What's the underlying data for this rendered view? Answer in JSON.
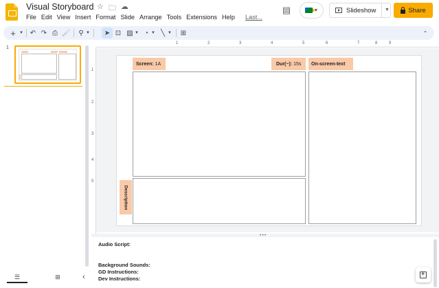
{
  "header": {
    "title": "Visual Storyboard",
    "menu": [
      "File",
      "Edit",
      "View",
      "Insert",
      "Format",
      "Slide",
      "Arrange",
      "Tools",
      "Extensions",
      "Help"
    ],
    "last_edit": "Last...",
    "slideshow_label": "Slideshow",
    "share_label": "Share",
    "accent": "#f9ab00"
  },
  "toolbar": {
    "new_label": "+",
    "zoom_icon": "zoom-icon"
  },
  "rulers": {
    "top": [
      "1",
      "2",
      "3",
      "4",
      "5",
      "6",
      "7",
      "8",
      "9"
    ],
    "left": [
      "1",
      "2",
      "3",
      "4",
      "5"
    ]
  },
  "filmstrip": {
    "slide_number": "1"
  },
  "slide": {
    "screen_label": "Screen:",
    "screen_value": "1A",
    "dur_label": "Dur(~):",
    "dur_value": "15s",
    "onscreen_label": "On-screen-text",
    "description_label": "Description",
    "label_color": "#f9c9a8"
  },
  "notes": {
    "audio_script": "Audio Script:",
    "background_sounds": "Background Sounds:",
    "gd_instructions": "GD Instructions:",
    "dev_instructions": "Dev Instructions:"
  }
}
